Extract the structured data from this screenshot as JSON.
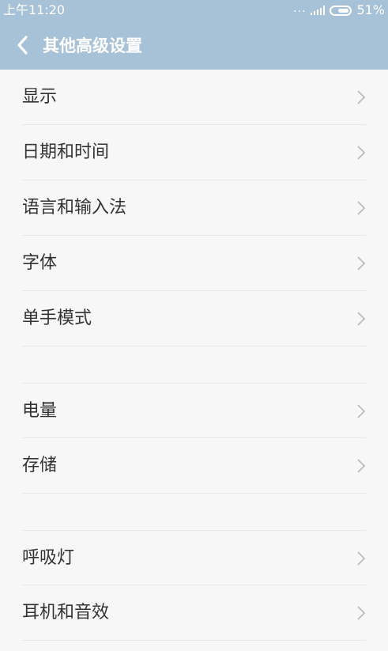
{
  "status_bar": {
    "time": "上午11:20",
    "dots": "...",
    "battery_percent": "51%",
    "icons": [
      "signal-icon",
      "battery-icon"
    ]
  },
  "header": {
    "title": "其他高级设置",
    "back_icon": "chevron-left-icon",
    "background_color": "#a7c2d6"
  },
  "groups": [
    {
      "items": [
        {
          "label": "显示"
        },
        {
          "label": "日期和时间"
        },
        {
          "label": "语言和输入法"
        },
        {
          "label": "字体"
        },
        {
          "label": "单手模式"
        }
      ]
    },
    {
      "items": [
        {
          "label": "电量"
        },
        {
          "label": "存储"
        }
      ]
    },
    {
      "items": [
        {
          "label": "呼吸灯"
        },
        {
          "label": "耳机和音效"
        }
      ]
    }
  ],
  "row_arrow_icon": "chevron-right-icon"
}
